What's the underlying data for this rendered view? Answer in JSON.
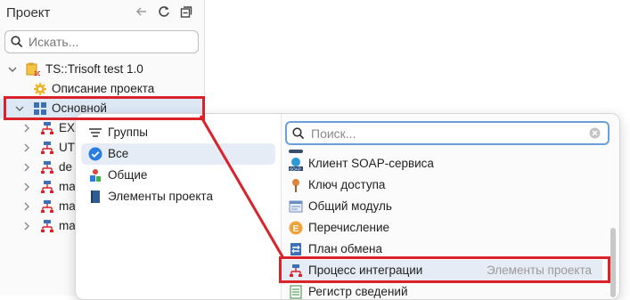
{
  "panel": {
    "title": "Проект",
    "search_placeholder": "Искать..."
  },
  "tree": [
    {
      "label": "TS::Trisoft test 1.0",
      "icon": "configuration-icon"
    },
    {
      "label": "Описание проекта",
      "icon": "gear-icon"
    },
    {
      "label": "Основной",
      "icon": "subsystem-icon"
    },
    {
      "label": "EX",
      "icon": "integration-process-icon"
    },
    {
      "label": "UT",
      "icon": "integration-process-icon"
    },
    {
      "label": "de",
      "icon": "integration-process-icon"
    },
    {
      "label": "ma",
      "icon": "integration-process-icon"
    },
    {
      "label": "ma",
      "icon": "integration-process-icon"
    },
    {
      "label": "ma",
      "icon": "integration-process-icon"
    }
  ],
  "popup": {
    "categories": [
      {
        "label": "Группы",
        "icon": "sort-icon"
      },
      {
        "label": "Все",
        "icon": "check-circle-icon"
      },
      {
        "label": "Общие",
        "icon": "common-icon"
      },
      {
        "label": "Элементы проекта",
        "icon": "book-icon"
      }
    ],
    "search_placeholder": "Поиск...",
    "items": [
      {
        "label": "Клиент SOAP-сервиса",
        "icon": "soap-icon",
        "category": ""
      },
      {
        "label": "Ключ доступа",
        "icon": "key-icon",
        "category": ""
      },
      {
        "label": "Общий модуль",
        "icon": "module-icon",
        "category": ""
      },
      {
        "label": "Перечисление",
        "icon": "enum-icon",
        "category": ""
      },
      {
        "label": "План обмена",
        "icon": "exchange-plan-icon",
        "category": ""
      },
      {
        "label": "Процесс интеграции",
        "icon": "integration-process-icon",
        "category": "Элементы проекта"
      },
      {
        "label": "Регистр сведений",
        "icon": "register-icon",
        "category": ""
      }
    ]
  },
  "colors": {
    "highlight": "#d9222a",
    "accent": "#2a7de1",
    "selection": "#dde8f5"
  }
}
